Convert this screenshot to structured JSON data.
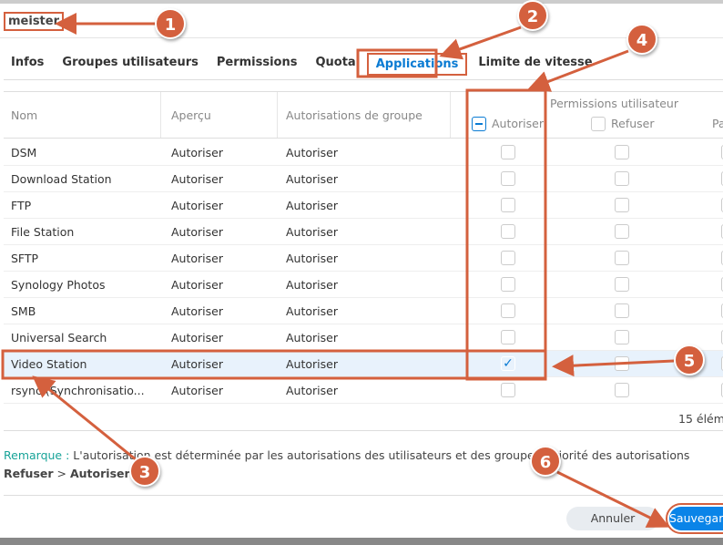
{
  "title": "meister",
  "tabs": [
    "Infos",
    "Groupes utilisateurs",
    "Permissions",
    "Quota",
    "Applications",
    "Limite de vitesse"
  ],
  "active_tab": "Applications",
  "headers": {
    "name": "Nom",
    "preview": "Aperçu",
    "group": "Autorisations de groupe",
    "user_perms": "Permissions utilisateur",
    "allow": "Autoriser",
    "deny": "Refuser",
    "third": "Pa"
  },
  "rows": [
    {
      "name": "DSM",
      "preview": "Autoriser",
      "group": "Autoriser",
      "allow": false
    },
    {
      "name": "Download Station",
      "preview": "Autoriser",
      "group": "Autoriser",
      "allow": false
    },
    {
      "name": "FTP",
      "preview": "Autoriser",
      "group": "Autoriser",
      "allow": false
    },
    {
      "name": "File Station",
      "preview": "Autoriser",
      "group": "Autoriser",
      "allow": false
    },
    {
      "name": "SFTP",
      "preview": "Autoriser",
      "group": "Autoriser",
      "allow": false
    },
    {
      "name": "Synology Photos",
      "preview": "Autoriser",
      "group": "Autoriser",
      "allow": false
    },
    {
      "name": "SMB",
      "preview": "Autoriser",
      "group": "Autoriser",
      "allow": false
    },
    {
      "name": "Universal Search",
      "preview": "Autoriser",
      "group": "Autoriser",
      "allow": false
    },
    {
      "name": "Video Station",
      "preview": "Autoriser",
      "group": "Autoriser",
      "allow": true
    },
    {
      "name": "rsync (Synchronisatio...",
      "preview": "Autoriser",
      "group": "Autoriser",
      "allow": false
    }
  ],
  "count": "15 élém",
  "remark": {
    "key": "Remarque :",
    "text": "L'autorisation est déterminée par les autorisations des utilisateurs et des groupes. Priorité des autorisations",
    "deny": "Refuser",
    "sep": ">",
    "allow": "Autoriser"
  },
  "buttons": {
    "cancel": "Annuler",
    "save": "Sauvegarder"
  },
  "annotations": [
    "1",
    "2",
    "3",
    "4",
    "5",
    "6"
  ],
  "colors": {
    "accent": "#0a7bd3",
    "annotation": "#d4603e"
  }
}
